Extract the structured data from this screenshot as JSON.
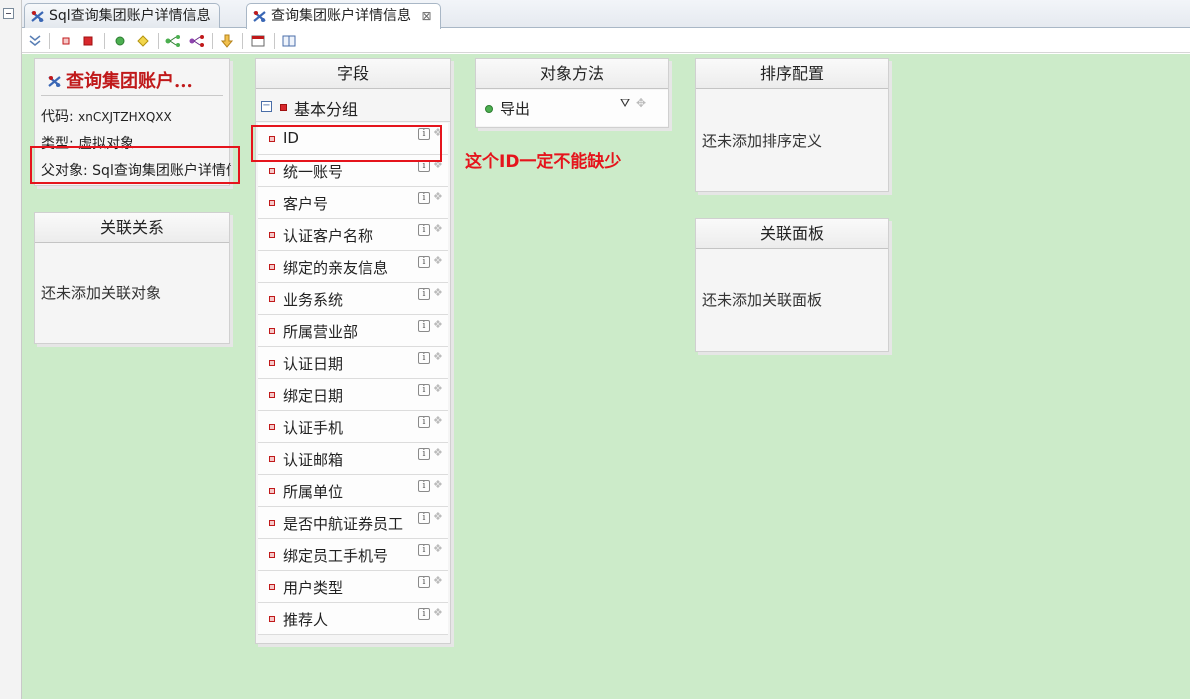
{
  "tabs": [
    {
      "label": "Sql查询集团账户详情信息",
      "active": false
    },
    {
      "label": "查询集团账户详情信息",
      "active": true,
      "close": "⊠"
    }
  ],
  "toolbar": {
    "icons": [
      "collapse-all-icon",
      "add-field-icon",
      "add-group-icon",
      "add-method-icon",
      "add-sort-icon",
      "relation-icon",
      "relation-tree-icon",
      "import-icon",
      "preview-icon",
      "book-icon"
    ]
  },
  "entity": {
    "title": "查询集团账户...",
    "code_label": "代码: ",
    "code": "xnCXJTZHXQXX",
    "type_label": "类型: ",
    "type": "虚拟对象",
    "parent_label": "父对象: ",
    "parent": "Sql查询集团账户详情信息"
  },
  "relations": {
    "title": "关联关系",
    "empty": "还未添加关联对象"
  },
  "fields": {
    "title": "字段",
    "group": "基本分组",
    "items": [
      "ID",
      "统一账号",
      "客户号",
      "认证客户名称",
      "绑定的亲友信息",
      "业务系统",
      "所属营业部",
      "认证日期",
      "绑定日期",
      "认证手机",
      "认证邮箱",
      "所属单位",
      "是否中航证券员工",
      "绑定员工手机号",
      "用户类型",
      "推荐人"
    ]
  },
  "methods": {
    "title": "对象方法",
    "items": [
      "导出"
    ]
  },
  "sort": {
    "title": "排序配置",
    "empty": "还未添加排序定义"
  },
  "panels": {
    "title": "关联面板",
    "empty": "还未添加关联面板"
  },
  "annotation": "这个ID一定不能缺少",
  "colors": {
    "canvas": "#ccebc9",
    "highlight": "#e5141c",
    "title": "#c0191a"
  }
}
